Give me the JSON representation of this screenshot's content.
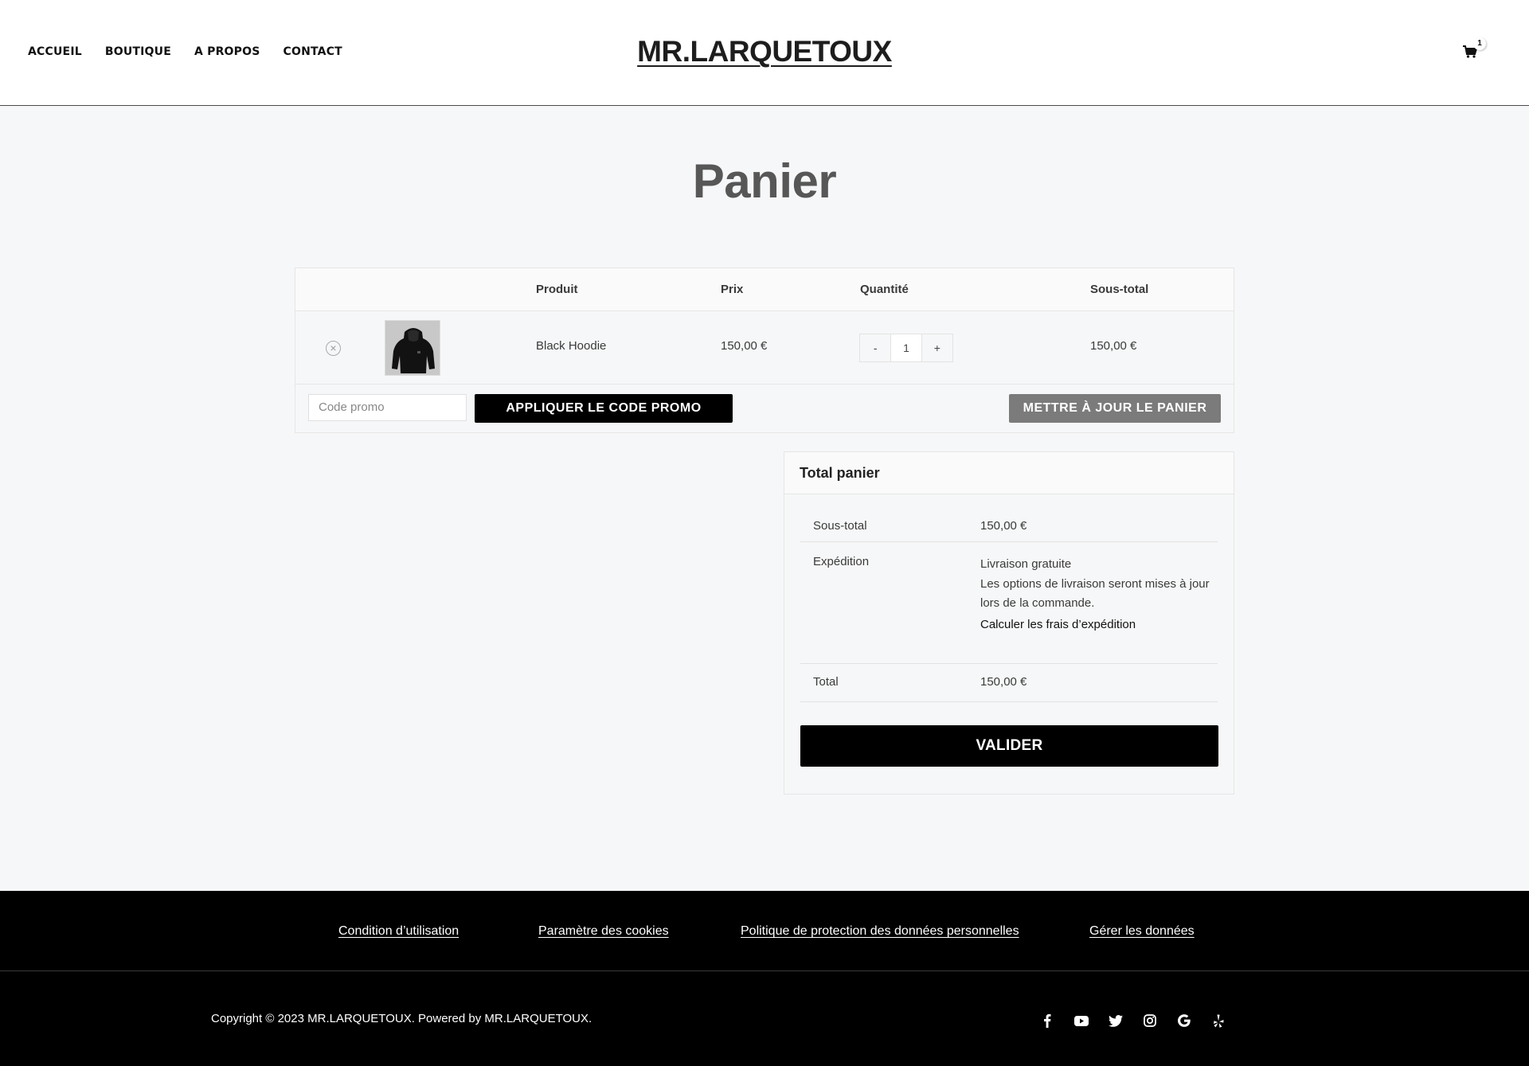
{
  "header": {
    "nav": [
      "ACCUEIL",
      "BOUTIQUE",
      "A PROPOS",
      "CONTACT"
    ],
    "logo": "MR.LARQUETOUX",
    "cart_count": "1"
  },
  "page": {
    "title": "Panier"
  },
  "cart": {
    "headers": {
      "product": "Produit",
      "price": "Prix",
      "quantity": "Quantité",
      "subtotal": "Sous-total"
    },
    "items": [
      {
        "name": "Black Hoodie",
        "price": "150,00 €",
        "quantity": "1",
        "subtotal": "150,00 €"
      }
    ],
    "qty_minus": "-",
    "qty_plus": "+",
    "coupon_placeholder": "Code promo",
    "apply_label": "APPLIQUER LE CODE PROMO",
    "update_label": "METTRE À JOUR LE PANIER"
  },
  "totals": {
    "title": "Total panier",
    "subtotal_label": "Sous-total",
    "subtotal_value": "150,00 €",
    "shipping_label": "Expédition",
    "shipping_method": "Livraison gratuite",
    "shipping_note": "Les options de livraison seront mises à jour lors de la commande.",
    "shipping_calc": "Calculer les frais d’expédition",
    "total_label": "Total",
    "total_value": "150,00 €",
    "checkout_label": "VALIDER"
  },
  "footer": {
    "links": [
      "Condition d’utilisation",
      "Paramètre des cookies",
      "Politique de protection des données personnelles",
      "Gérer les données"
    ],
    "copyright": "Copyright © 2023 MR.LARQUETOUX. Powered by MR.LARQUETOUX.",
    "social_icons": [
      "facebook-icon",
      "youtube-icon",
      "twitter-icon",
      "instagram-icon",
      "google-icon",
      "yelp-icon"
    ]
  },
  "colors": {
    "accent": "#000000",
    "update_button": "#7b7b7b",
    "title": "#575757",
    "background": "#f6f7f8"
  }
}
